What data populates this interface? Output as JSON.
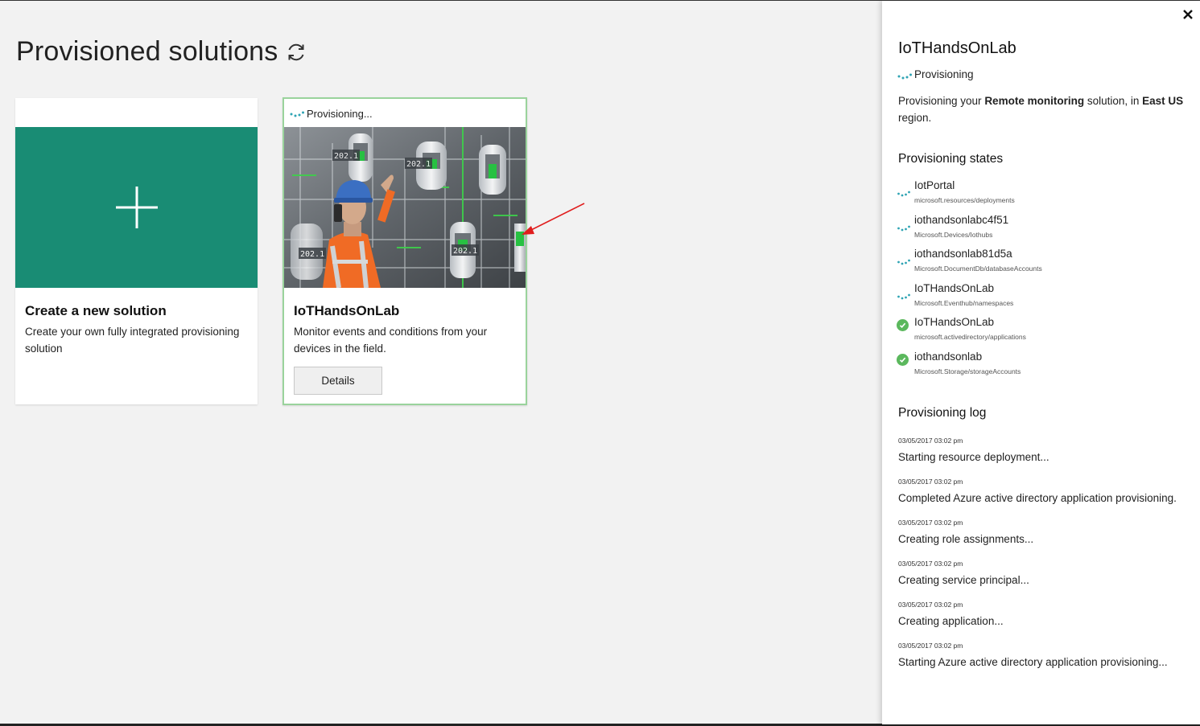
{
  "header": {
    "title": "Provisioned solutions",
    "refresh_icon": "refresh-icon"
  },
  "new_card": {
    "title": "Create a new solution",
    "description": "Create your own fully integrated provisioning solution",
    "accent": "#198c74"
  },
  "solution_card": {
    "status": "Provisioning...",
    "title": "IoTHandsOnLab",
    "description": "Monitor events and conditions from your devices in the field.",
    "details_label": "Details"
  },
  "panel": {
    "title": "IoTHandsOnLab",
    "status": "Provisioning",
    "desc_pre": "Provisioning your ",
    "desc_solution": "Remote monitoring",
    "desc_mid": " solution, in ",
    "desc_region": "East US",
    "desc_post": " region.",
    "states_heading": "Provisioning states",
    "states": [
      {
        "name": "IotPortal",
        "type": "microsoft.resources/deployments",
        "status": "in-progress"
      },
      {
        "name": "iothandsonlabc4f51",
        "type": "Microsoft.Devices/Iothubs",
        "status": "in-progress"
      },
      {
        "name": "iothandsonlab81d5a",
        "type": "Microsoft.DocumentDb/databaseAccounts",
        "status": "in-progress"
      },
      {
        "name": "IoTHandsOnLab",
        "type": "Microsoft.Eventhub/namespaces",
        "status": "in-progress"
      },
      {
        "name": "IoTHandsOnLab",
        "type": "microsoft.activedirectory/applications",
        "status": "completed"
      },
      {
        "name": "iothandsonlab",
        "type": "Microsoft.Storage/storageAccounts",
        "status": "completed"
      }
    ],
    "log_heading": "Provisioning log",
    "log": [
      {
        "time": "03/05/2017 03:02 pm",
        "message": "Starting resource deployment..."
      },
      {
        "time": "03/05/2017 03:02 pm",
        "message": "Completed Azure active directory application provisioning."
      },
      {
        "time": "03/05/2017 03:02 pm",
        "message": "Creating role assignments..."
      },
      {
        "time": "03/05/2017 03:02 pm",
        "message": "Creating service principal..."
      },
      {
        "time": "03/05/2017 03:02 pm",
        "message": "Creating application..."
      },
      {
        "time": "03/05/2017 03:02 pm",
        "message": "Starting Azure active directory application provisioning..."
      }
    ]
  },
  "colors": {
    "accent": "#198c74",
    "success": "#5bb85d",
    "spinner": "#2fa4b4",
    "selected_border": "#9ad39c",
    "arrow": "#e01e1e"
  }
}
